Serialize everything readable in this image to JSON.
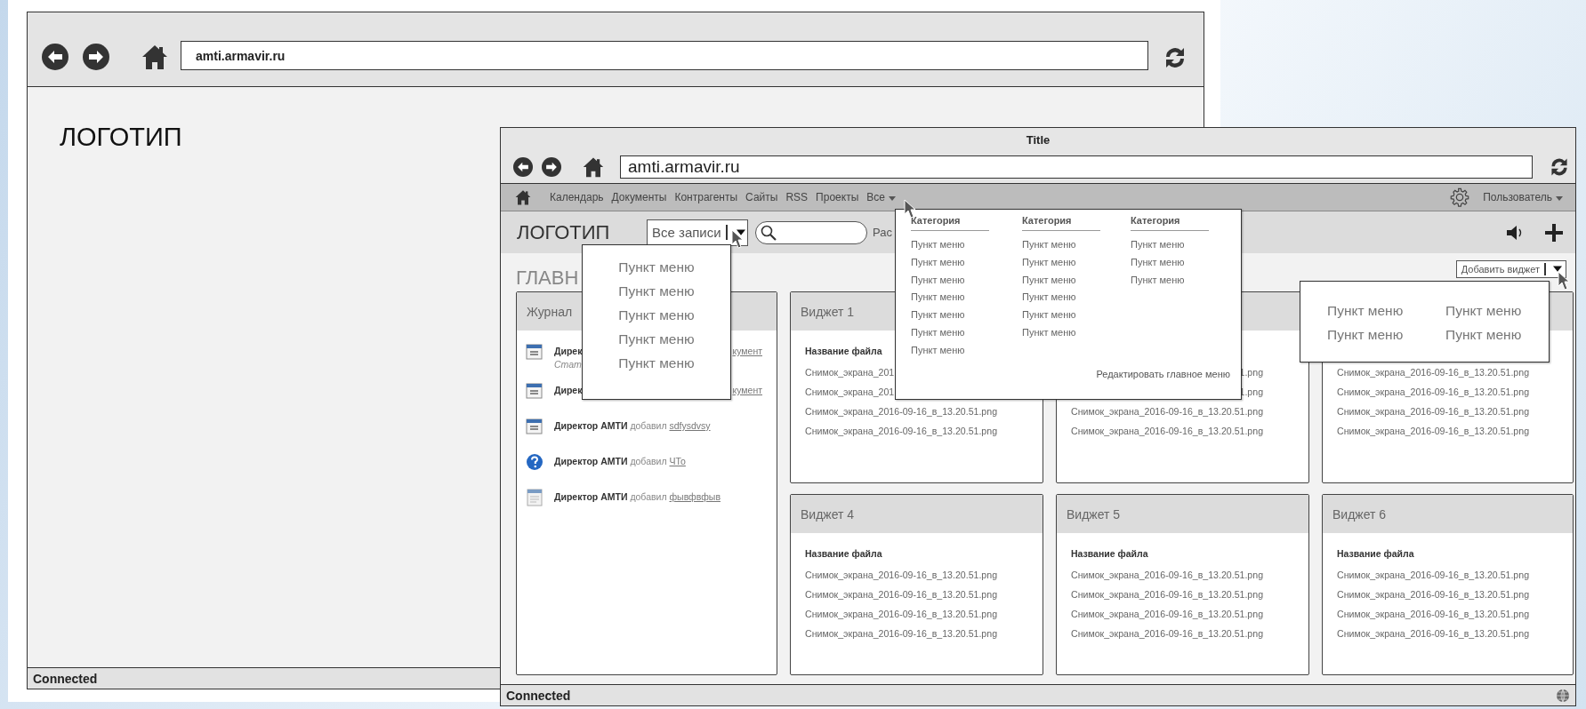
{
  "background_window": {
    "url": "amti.armavir.ru",
    "logo": "ЛОГОТИП",
    "status": "Connected"
  },
  "window": {
    "title": "Title",
    "url": "amti.armavir.ru"
  },
  "nav": {
    "items": [
      "Календарь",
      "Документы",
      "Контрагенты",
      "Сайты",
      "RSS",
      "Проекты"
    ],
    "more": "Все",
    "user": "Пользователь"
  },
  "header": {
    "logo": "ЛОГОТИП",
    "filter": "Все записи",
    "partial_label": "Рас"
  },
  "page_title": "ГЛАВН",
  "add_widget": "Добавить виджет",
  "journal": {
    "title": "Журнал",
    "entries": [
      {
        "kind": "partial",
        "lead": "Дирек",
        "tail": "кумент",
        "status": "Стат"
      },
      {
        "kind": "partial",
        "lead": "Дирек",
        "tail": "кумент"
      },
      {
        "kind": "full",
        "author": "Директор АМТИ",
        "action": "добавил",
        "link": "sdfysdvsy"
      },
      {
        "kind": "full",
        "author": "Директор АМТИ",
        "action": "добавил",
        "link": "ЧТо"
      },
      {
        "kind": "full",
        "author": "Директор АМТИ",
        "action": "добавил",
        "link": "фывфвфыв"
      }
    ]
  },
  "widgets": [
    {
      "title": "Виджет 1",
      "caption": "Название файла",
      "files": [
        {
          "kind": "head",
          "text": "Снимок_экрана_201"
        },
        {
          "kind": "head",
          "text": "Снимок_экрана_201"
        },
        {
          "kind": "full",
          "text": "Снимок_экрана_2016-09-16_в_13.20.51.png"
        },
        {
          "kind": "full",
          "text": "Снимок_экрана_2016-09-16_в_13.20.51.png"
        }
      ]
    },
    {
      "files": [
        {
          "kind": "tail",
          "text": "1.png"
        },
        {
          "kind": "tail",
          "text": "1.png"
        },
        {
          "kind": "full",
          "text": "Снимок_экрана_2016-09-16_в_13.20.51.png"
        },
        {
          "kind": "full",
          "text": "Снимок_экрана_2016-09-16_в_13.20.51.png"
        }
      ]
    },
    {
      "files": [
        {
          "kind": "full",
          "text": "Снимок_экрана_2016-09-16_в_13.20.51.png"
        },
        {
          "kind": "full",
          "text": "Снимок_экрана_2016-09-16_в_13.20.51.png"
        },
        {
          "kind": "full",
          "text": "Снимок_экрана_2016-09-16_в_13.20.51.png"
        },
        {
          "kind": "full",
          "text": "Снимок_экрана_2016-09-16_в_13.20.51.png"
        }
      ]
    },
    {
      "title": "Виджет 4",
      "caption": "Название файла",
      "files": [
        {
          "kind": "full",
          "text": "Снимок_экрана_2016-09-16_в_13.20.51.png"
        },
        {
          "kind": "full",
          "text": "Снимок_экрана_2016-09-16_в_13.20.51.png"
        },
        {
          "kind": "full",
          "text": "Снимок_экрана_2016-09-16_в_13.20.51.png"
        },
        {
          "kind": "full",
          "text": "Снимок_экрана_2016-09-16_в_13.20.51.png"
        }
      ]
    },
    {
      "title": "Виджет 5",
      "caption": "Название файла",
      "files": [
        {
          "kind": "full",
          "text": "Снимок_экрана_2016-09-16_в_13.20.51.png"
        },
        {
          "kind": "full",
          "text": "Снимок_экрана_2016-09-16_в_13.20.51.png"
        },
        {
          "kind": "full",
          "text": "Снимок_экрана_2016-09-16_в_13.20.51.png"
        },
        {
          "kind": "full",
          "text": "Снимок_экрана_2016-09-16_в_13.20.51.png"
        }
      ]
    },
    {
      "title": "Виджет 6",
      "caption": "Название файла",
      "files": [
        {
          "kind": "full",
          "text": "Снимок_экрана_2016-09-16_в_13.20.51.png"
        },
        {
          "kind": "full",
          "text": "Снимок_экрана_2016-09-16_в_13.20.51.png"
        },
        {
          "kind": "full",
          "text": "Снимок_экрана_2016-09-16_в_13.20.51.png"
        },
        {
          "kind": "full",
          "text": "Снимок_экрана_2016-09-16_в_13.20.51.png"
        }
      ]
    }
  ],
  "records_menu": {
    "items": [
      "Пункт меню",
      "Пункт меню",
      "Пункт меню",
      "Пункт меню",
      "Пункт меню"
    ]
  },
  "all_menu": {
    "columns": [
      {
        "heading": "Категория",
        "items": [
          "Пункт меню",
          "Пункт меню",
          "Пункт меню",
          "Пункт меню",
          "Пункт меню",
          "Пункт меню",
          "Пункт меню"
        ]
      },
      {
        "heading": "Категория",
        "items": [
          "Пункт меню",
          "Пункт меню",
          "Пункт меню",
          "Пункт меню",
          "Пункт меню",
          "Пункт меню"
        ]
      },
      {
        "heading": "Категория",
        "items": [
          "Пункт меню",
          "Пункт меню",
          "Пункт меню"
        ]
      }
    ],
    "footer": "Редактировать главное меню"
  },
  "widget_menu": {
    "items": [
      "Пункт меню",
      "Пункт меню",
      "Пункт меню",
      "Пункт меню"
    ]
  },
  "status_bar": {
    "text": "Connected"
  }
}
